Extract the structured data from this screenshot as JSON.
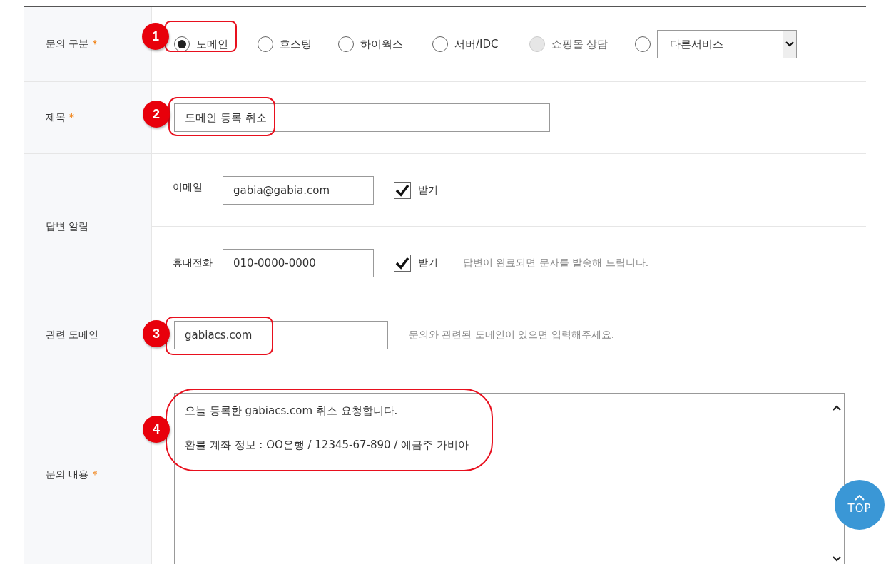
{
  "form": {
    "category": {
      "label": "문의 구분",
      "required_mark": "*",
      "annotation": "1",
      "options": [
        {
          "label": "도메인",
          "selected": true,
          "disabled": false
        },
        {
          "label": "호스팅",
          "selected": false,
          "disabled": false
        },
        {
          "label": "하이웍스",
          "selected": false,
          "disabled": false
        },
        {
          "label": "서버/IDC",
          "selected": false,
          "disabled": false
        },
        {
          "label": "쇼핑몰 상담",
          "selected": false,
          "disabled": true
        }
      ],
      "other": {
        "selected": false,
        "select_value": "다른서비스"
      }
    },
    "title": {
      "label": "제목",
      "required_mark": "*",
      "annotation": "2",
      "value": "도메인 등록 취소"
    },
    "notify": {
      "label": "답변 알림",
      "email": {
        "label": "이메일",
        "value": "gabia@gabia.com",
        "checkbox_label": "받기",
        "checked": true
      },
      "phone": {
        "label": "휴대전화",
        "value": "010-0000-0000",
        "checkbox_label": "받기",
        "checked": true,
        "hint": "답변이 완료되면 문자를 발송해 드립니다."
      }
    },
    "domain": {
      "label": "관련 도메인",
      "annotation": "3",
      "value": "gabiacs.com",
      "hint": "문의와 관련된 도메인이 있으면 입력해주세요."
    },
    "content": {
      "label": "문의 내용",
      "required_mark": "*",
      "annotation": "4",
      "lines": [
        "오늘 등록한 gabiacs.com 취소 요청합니다.",
        "환불 계좌 정보 : OO은행 / 12345-67-890 / 예금주 가비아"
      ]
    }
  },
  "top_button": {
    "label": "TOP"
  }
}
